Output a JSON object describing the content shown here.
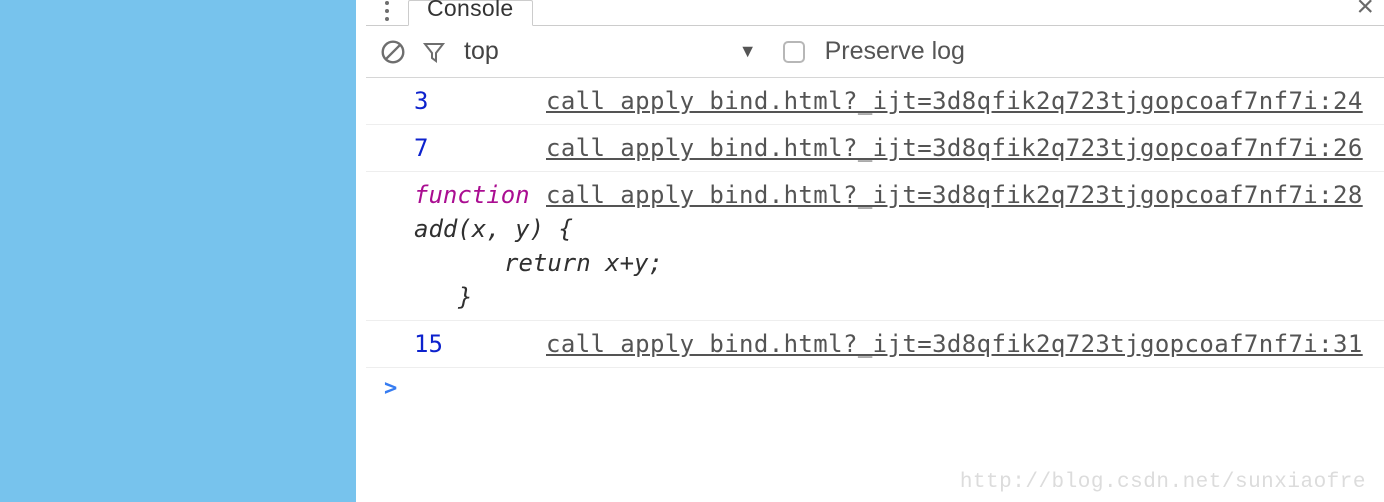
{
  "tabbar": {
    "active_tab": "Console"
  },
  "toolbar": {
    "context": "top",
    "preserve_label": "Preserve log"
  },
  "log": {
    "rows": [
      {
        "msg": "3",
        "msg_type": "num",
        "src": "call apply bind.html?_ijt=3d8qfik2q723tjgopcoaf7nf7i:24"
      },
      {
        "msg": "7",
        "msg_type": "num",
        "src": "call apply bind.html?_ijt=3d8qfik2q723tjgopcoaf7nf7i:26"
      },
      {
        "msg": "function",
        "msg_type": "kw",
        "src": "call apply bind.html?_ijt=3d8qfik2q723tjgopcoaf7nf7i:28",
        "cont": {
          "l1": "add(x, y) {",
          "l2": "return x+y;",
          "l3": "}"
        }
      },
      {
        "msg": "15",
        "msg_type": "num",
        "src": "call apply bind.html?_ijt=3d8qfik2q723tjgopcoaf7nf7i:31"
      }
    ],
    "prompt": ">"
  },
  "watermark": "http://blog.csdn.net/sunxiaofre"
}
